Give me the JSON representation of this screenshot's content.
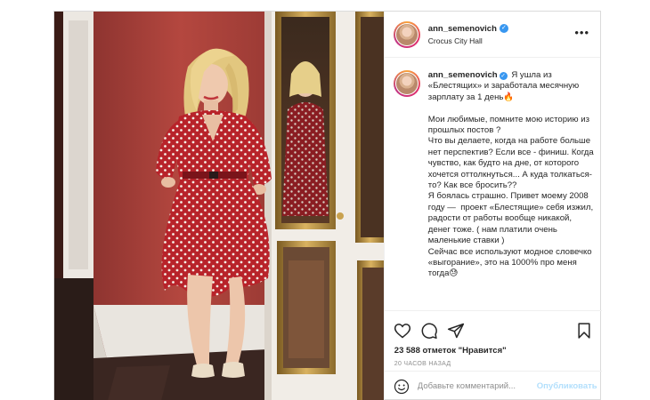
{
  "post": {
    "username": "ann_semenovich",
    "location": "Crocus City Hall",
    "caption": {
      "username": "ann_semenovich",
      "text": " Я ушла из «Блестящих» и заработала месячную зарплату за 1 день🔥\n\nМои любимые, помните мою историю из прошлых постов ?\nЧто вы делаете, когда на работе больше нет перспектив? Если все - финиш. Когда чувство, как будто на дне, от которого хочется оттолкнуться... А куда толкаться-то? Как все бросить??\nЯ боялась страшно. Привет моему 2008 году —  проект «Блестящие» себя изжил, радости от работы вообще никакой, денег тоже. ( нам платили очень маленькие ставки )\nСейчас все используют модное словечко «выгорание», это на 1000% про меня тогда😓"
    },
    "likes_text": "23 588 отметок \"Нравится\"",
    "time_text": "20 ЧАСОВ НАЗАД",
    "comment": {
      "placeholder": "Добавьте комментарий...",
      "value": "",
      "publish_label": "Опубликовать"
    }
  },
  "colors": {
    "verified": "#3897f0",
    "publish_disabled": "#b2dffc",
    "dress_red": "#b8232a",
    "wall_red": "#a8413a"
  },
  "icons": {
    "more": "more-dots-icon",
    "like": "heart-icon",
    "comment": "comment-bubble-icon",
    "share": "paper-plane-icon",
    "save": "bookmark-icon",
    "emoji": "smiley-icon"
  }
}
